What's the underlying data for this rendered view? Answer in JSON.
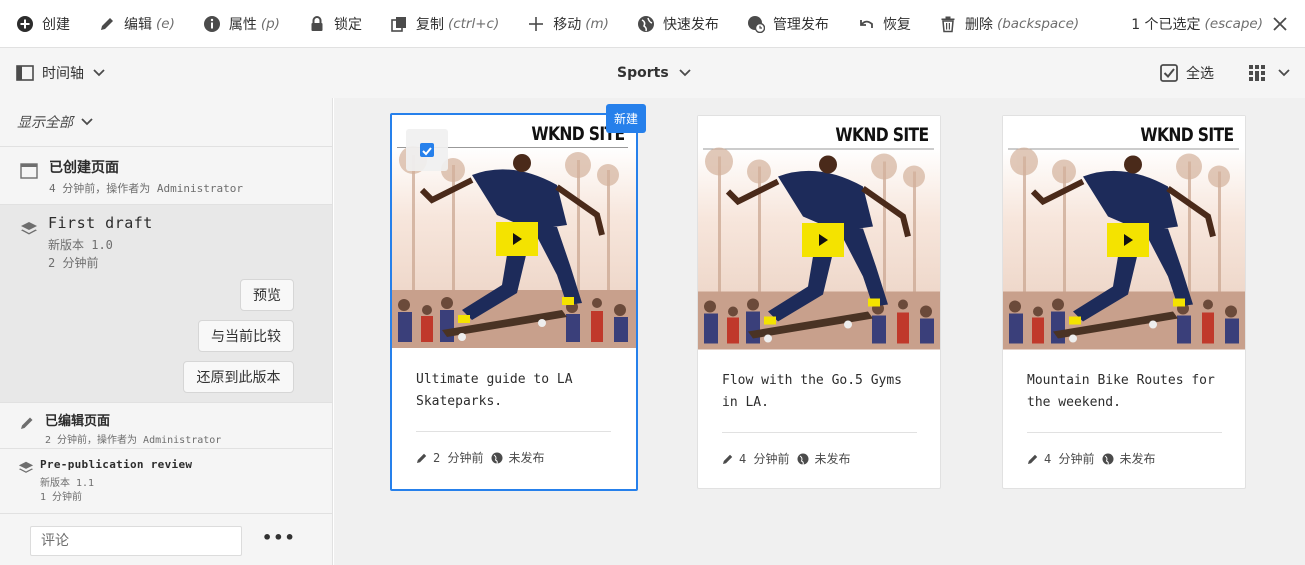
{
  "actions": {
    "create": {
      "label": "创建"
    },
    "edit": {
      "label": "编辑",
      "shortcut": "(e)"
    },
    "properties": {
      "label": "属性",
      "shortcut": "(p)"
    },
    "lock": {
      "label": "锁定"
    },
    "copy": {
      "label": "复制",
      "shortcut": "(ctrl+c)"
    },
    "move": {
      "label": "移动",
      "shortcut": "(m)"
    },
    "quick_publish": {
      "label": "快速发布"
    },
    "manage_publication": {
      "label": "管理发布"
    },
    "restore": {
      "label": "恢复"
    },
    "delete": {
      "label": "删除",
      "shortcut": "(backspace)"
    },
    "selection": {
      "label": "1 个已选定",
      "shortcut": "(escape)"
    }
  },
  "viewbar": {
    "rail_label": "时间轴",
    "title": "Sports",
    "select_all": "全选"
  },
  "rail": {
    "filter": "显示全部",
    "items": [
      {
        "title": "已创建页面",
        "line1": "4 分钟前，操作者为 Administrator",
        "icon": "page-icon"
      },
      {
        "title": "First draft",
        "line1": "新版本 1.0",
        "line2": "2 分钟前",
        "icon": "layers-icon"
      },
      {
        "title": "已编辑页面",
        "line1": "2 分钟前，操作者为 Administrator",
        "icon": "pencil-icon"
      },
      {
        "title": "Pre-publication review",
        "line1": "新版本 1.1",
        "line2": "1 分钟前",
        "icon": "layers-icon"
      }
    ],
    "buttons": {
      "preview": "预览",
      "compare": "与当前比较",
      "revert": "还原到此版本"
    },
    "comment_placeholder": "评论",
    "more": "•••"
  },
  "cards": [
    {
      "brand": "WKND SITE",
      "title": "Ultimate guide to LA Skateparks.",
      "modified": "2 分钟前",
      "status": "未发布",
      "badge": "新建",
      "selected": true
    },
    {
      "brand": "WKND SITE",
      "title": "Flow with the Go.5 Gyms in LA.",
      "modified": "4 分钟前",
      "status": "未发布",
      "selected": false
    },
    {
      "brand": "WKND SITE",
      "title": "Mountain Bike Routes for the weekend.",
      "modified": "4 分钟前",
      "status": "未发布",
      "selected": false
    }
  ],
  "colors": {
    "accent": "#2680eb",
    "play": "#f4e300",
    "rail_bg": "#f5f5f5",
    "content_bg": "#f0f0f0"
  }
}
